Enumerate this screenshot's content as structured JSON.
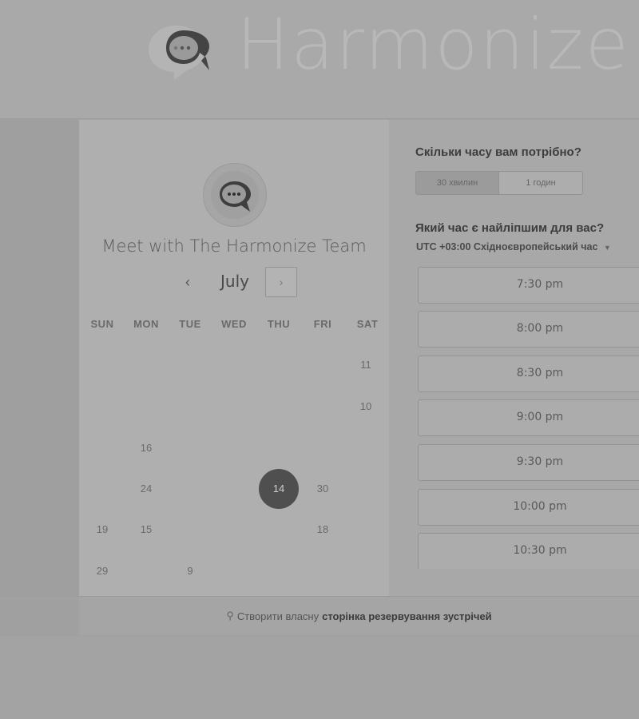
{
  "brand": {
    "name": "Harmonize",
    "logo_icon": "chat-bubble-logo-icon"
  },
  "calendar": {
    "title": "Meet with The Harmonize Team",
    "month": "July",
    "prev_symbol": "‹",
    "next_symbol": "›",
    "weekdays": [
      "SUN",
      "MON",
      "TUE",
      "WED",
      "THU",
      "FRI",
      "SAT"
    ],
    "days": [
      {
        "label": "11",
        "col": 6,
        "row": 0
      },
      {
        "label": "10",
        "col": 6,
        "row": 1
      },
      {
        "label": "16",
        "col": 1,
        "row": 2
      },
      {
        "label": "24",
        "col": 1,
        "row": 3
      },
      {
        "label": "14",
        "col": 4,
        "row": 3,
        "selected": true
      },
      {
        "label": "30",
        "col": 5,
        "row": 3
      },
      {
        "label": "19",
        "col": 0,
        "row": 4
      },
      {
        "label": "15",
        "col": 1,
        "row": 4
      },
      {
        "label": "18",
        "col": 5,
        "row": 4
      },
      {
        "label": "29",
        "col": 0,
        "row": 5
      },
      {
        "label": "9",
        "col": 2,
        "row": 5
      }
    ]
  },
  "booking": {
    "duration_question": "Скільки часу вам потрібно?",
    "durations": [
      "30 хвилин",
      "1 годин"
    ],
    "selected_duration": "30 хвилин",
    "time_question": "Який час є найліпшим для вас?",
    "timezone_offset": "UTC +03:00",
    "timezone_name": "Східноєвропейський час",
    "slots": [
      "7:30 pm",
      "8:00 pm",
      "8:30 pm",
      "9:00 pm",
      "9:30 pm",
      "10:00 pm",
      "10:30 pm"
    ]
  },
  "footer": {
    "prefix": "Створити власну",
    "link_text": "сторінка резервування зустрічей",
    "icon": "sprocket-icon"
  },
  "colors": {
    "selected_day": "#4f4f4f",
    "page_overlay": "#a3a3a3"
  }
}
